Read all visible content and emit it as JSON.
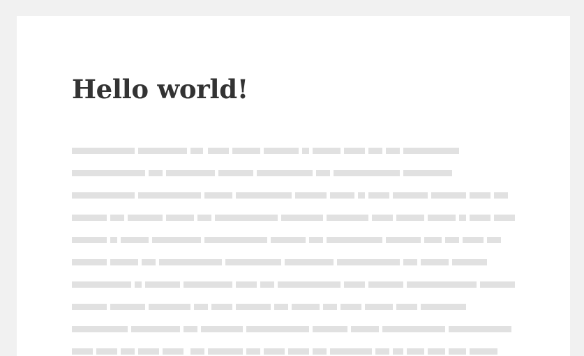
{
  "post": {
    "title": "Hello world!"
  },
  "colors": {
    "page_background": "#f1f1f1",
    "card_background": "#ffffff",
    "title_text": "#333333",
    "placeholder_text": "#e1e1e1"
  }
}
